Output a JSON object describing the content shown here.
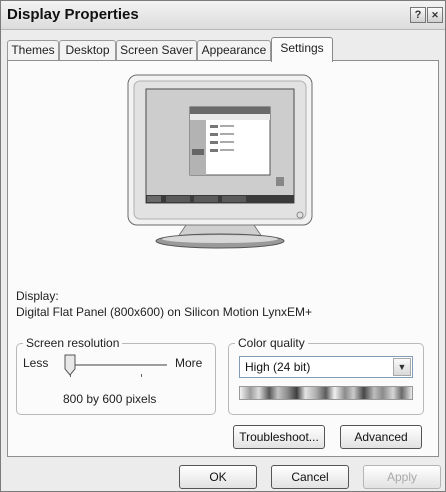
{
  "window": {
    "title": "Display Properties",
    "help_glyph": "?",
    "close_glyph": "✕"
  },
  "tabs": [
    {
      "label": "Themes",
      "active": false
    },
    {
      "label": "Desktop",
      "active": false
    },
    {
      "label": "Screen Saver",
      "active": false
    },
    {
      "label": "Appearance",
      "active": false
    },
    {
      "label": "Settings",
      "active": true
    }
  ],
  "display": {
    "label": "Display:",
    "device": "Digital Flat Panel (800x600) on Silicon Motion LynxEM+"
  },
  "screen_resolution": {
    "legend": "Screen resolution",
    "less_label": "Less",
    "more_label": "More",
    "value_text": "800 by 600 pixels",
    "slider_level": 0
  },
  "color_quality": {
    "legend": "Color quality",
    "selected": "High (24 bit)"
  },
  "buttons": {
    "troubleshoot": "Troubleshoot...",
    "advanced": "Advanced",
    "ok": "OK",
    "cancel": "Cancel",
    "apply": "Apply"
  }
}
